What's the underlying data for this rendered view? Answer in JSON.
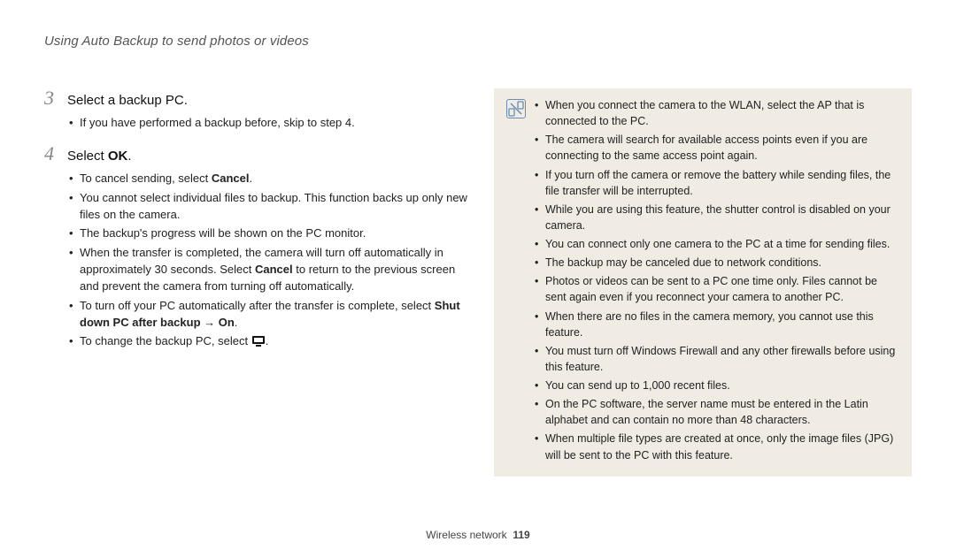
{
  "header": {
    "title": "Using Auto Backup to send photos or videos"
  },
  "steps": [
    {
      "num": "3",
      "title_plain": "Select a backup PC.",
      "bullets": [
        {
          "text": "If you have performed a backup before, skip to step 4."
        }
      ]
    },
    {
      "num": "4",
      "title_prefix": "Select ",
      "title_bold": "OK",
      "title_suffix": ".",
      "bullets": [
        {
          "prefix": "To cancel sending, select ",
          "bold": "Cancel",
          "suffix": "."
        },
        {
          "text": "You cannot select individual files to backup. This function backs up only new files on the camera."
        },
        {
          "text": "The backup's progress will be shown on the PC monitor."
        },
        {
          "prefix": "When the transfer is completed, the camera will turn off automatically in approximately 30 seconds. Select ",
          "bold": "Cancel",
          "suffix": " to return to the previous screen and prevent the camera from turning off automatically."
        },
        {
          "prefix": "To turn off your PC automatically after the transfer is complete, select ",
          "bold": "Shut down PC after backup → On",
          "suffix": "."
        },
        {
          "prefix": "To change the backup PC, select ",
          "icon": "monitor-icon",
          "suffix": "."
        }
      ]
    }
  ],
  "note": {
    "items": [
      "When you connect the camera to the WLAN, select the AP that is connected to the PC.",
      "The camera will search for available access points even if you are connecting to the same access point again.",
      "If you turn off the camera or remove the battery while sending files, the file transfer will be interrupted.",
      "While you are using this feature, the shutter control is disabled on your camera.",
      "You can connect only one camera to the PC at a time for sending files.",
      "The backup may be canceled due to network conditions.",
      "Photos or videos can be sent to a PC one time only. Files cannot be sent again even if you reconnect your camera to another PC.",
      "When there are no files in the camera memory, you cannot use this feature.",
      "You must turn off Windows Firewall and any other firewalls before using this feature.",
      "You can send up to 1,000 recent files.",
      "On the PC software, the server name must be entered in the Latin alphabet and can contain no more than 48 characters.",
      "When multiple file types are created at once, only the image files (JPG) will be sent to the PC with this feature."
    ]
  },
  "footer": {
    "section": "Wireless network",
    "page": "119"
  }
}
